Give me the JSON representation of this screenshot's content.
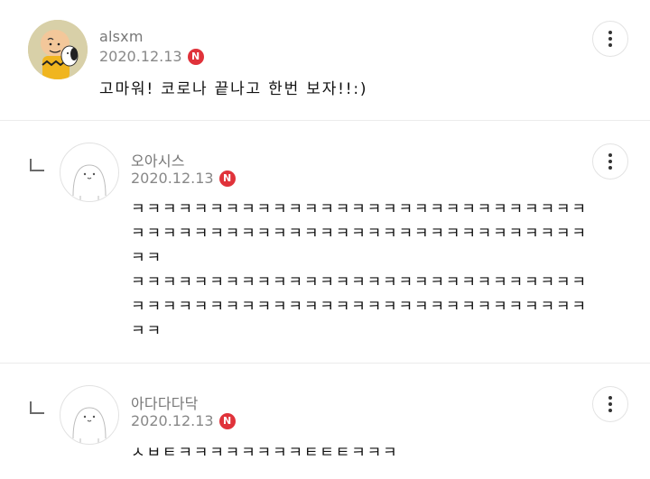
{
  "comments": [
    {
      "username": "alsxm",
      "date": "2020.12.13",
      "badge": "N",
      "text_lines": [
        "고마워! 코로나 끝나고 한번 보자!!:)"
      ],
      "avatar_icon": "charlie-brown-snoopy-avatar-icon"
    },
    {
      "username": "오아시스",
      "date": "2020.12.13",
      "badge": "N",
      "text_lines": [
        "ㅋㅋㅋㅋㅋㅋㅋㅋㅋㅋㅋㅋㅋㅋㅋㅋㅋㅋㅋㅋㅋㅋㅋㅋㅋㅋㅋㅋㅋ",
        "ㅋㅋㅋㅋㅋㅋㅋㅋㅋㅋㅋㅋㅋㅋㅋㅋㅋㅋㅋㅋㅋㅋㅋㅋㅋㅋㅋㅋㅋ",
        "ㅋㅋ",
        "ㅋㅋㅋㅋㅋㅋㅋㅋㅋㅋㅋㅋㅋㅋㅋㅋㅋㅋㅋㅋㅋㅋㅋㅋㅋㅋㅋㅋㅋ",
        "ㅋㅋㅋㅋㅋㅋㅋㅋㅋㅋㅋㅋㅋㅋㅋㅋㅋㅋㅋㅋㅋㅋㅋㅋㅋㅋㅋㅋㅋ",
        "ㅋㅋ"
      ],
      "avatar_icon": "default-profile-icon"
    },
    {
      "username": "아다다다닥",
      "date": "2020.12.13",
      "badge": "N",
      "text_lines": [
        "ㅅㅂㅌㅋㅋㅋㅋㅋㅋㅋㅋㅌㅌㅌㅋㅋㅋ"
      ],
      "avatar_icon": "default-profile-icon"
    }
  ],
  "colors": {
    "badge": "#e0323a",
    "meta_text": "#888888",
    "divider": "#ececec"
  }
}
